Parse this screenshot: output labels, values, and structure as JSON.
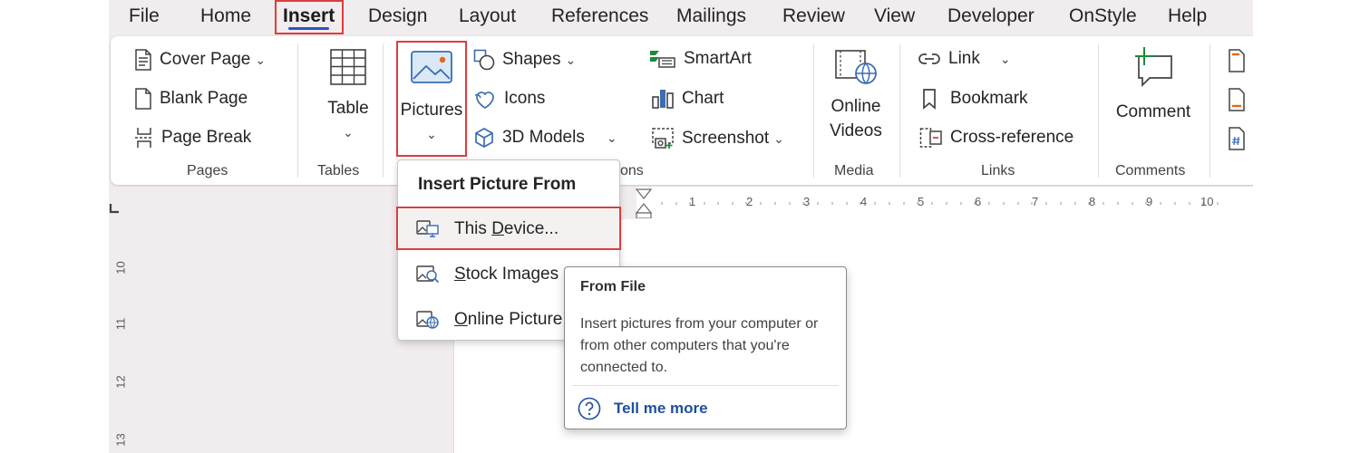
{
  "tabs": [
    {
      "label": "File"
    },
    {
      "label": "Home"
    },
    {
      "label": "Insert",
      "active": true
    },
    {
      "label": "Design"
    },
    {
      "label": "Layout"
    },
    {
      "label": "References"
    },
    {
      "label": "Mailings"
    },
    {
      "label": "Review"
    },
    {
      "label": "View"
    },
    {
      "label": "Developer"
    },
    {
      "label": "OnStyle"
    },
    {
      "label": "Help"
    }
  ],
  "ribbon": {
    "pages": {
      "cover_page": "Cover Page",
      "blank_page": "Blank Page",
      "page_break": "Page Break",
      "group_label": "Pages"
    },
    "tables": {
      "table": "Table",
      "group_label": "Tables"
    },
    "illustrations": {
      "pictures": "Pictures",
      "shapes": "Shapes",
      "icons": "Icons",
      "models": "3D Models",
      "smartart": "SmartArt",
      "chart": "Chart",
      "screenshot": "Screenshot",
      "group_label_visible": "ons"
    },
    "media": {
      "online_line1": "Online",
      "online_line2": "Videos",
      "group_label": "Media"
    },
    "links": {
      "link": "Link",
      "bookmark": "Bookmark",
      "cross_reference": "Cross-reference",
      "group_label": "Links"
    },
    "comments": {
      "comment": "Comment",
      "group_label": "Comments"
    }
  },
  "ruler": {
    "h_numbers": [
      "1",
      "2",
      "3",
      "4",
      "5",
      "6",
      "7",
      "8",
      "9",
      "10"
    ],
    "v_numbers": [
      "10",
      "11",
      "12",
      "13"
    ]
  },
  "dropdown": {
    "header": "Insert Picture From",
    "items": [
      {
        "label_pre": "This ",
        "label_u": "D",
        "label_post": "evice...",
        "highlighted": true
      },
      {
        "label_pre": "",
        "label_u": "S",
        "label_post": "tock Images",
        "highlighted": false
      },
      {
        "label_pre": "",
        "label_u": "O",
        "label_post": "nline Picture",
        "highlighted": false
      }
    ]
  },
  "tooltip": {
    "title": "From File",
    "body": "Insert pictures from your computer or from other computers that you're connected to.",
    "link": "Tell me more"
  },
  "colors": {
    "accent": "#2b55c4",
    "highlight_border": "#e03c3c",
    "link": "#1f4f9e"
  }
}
